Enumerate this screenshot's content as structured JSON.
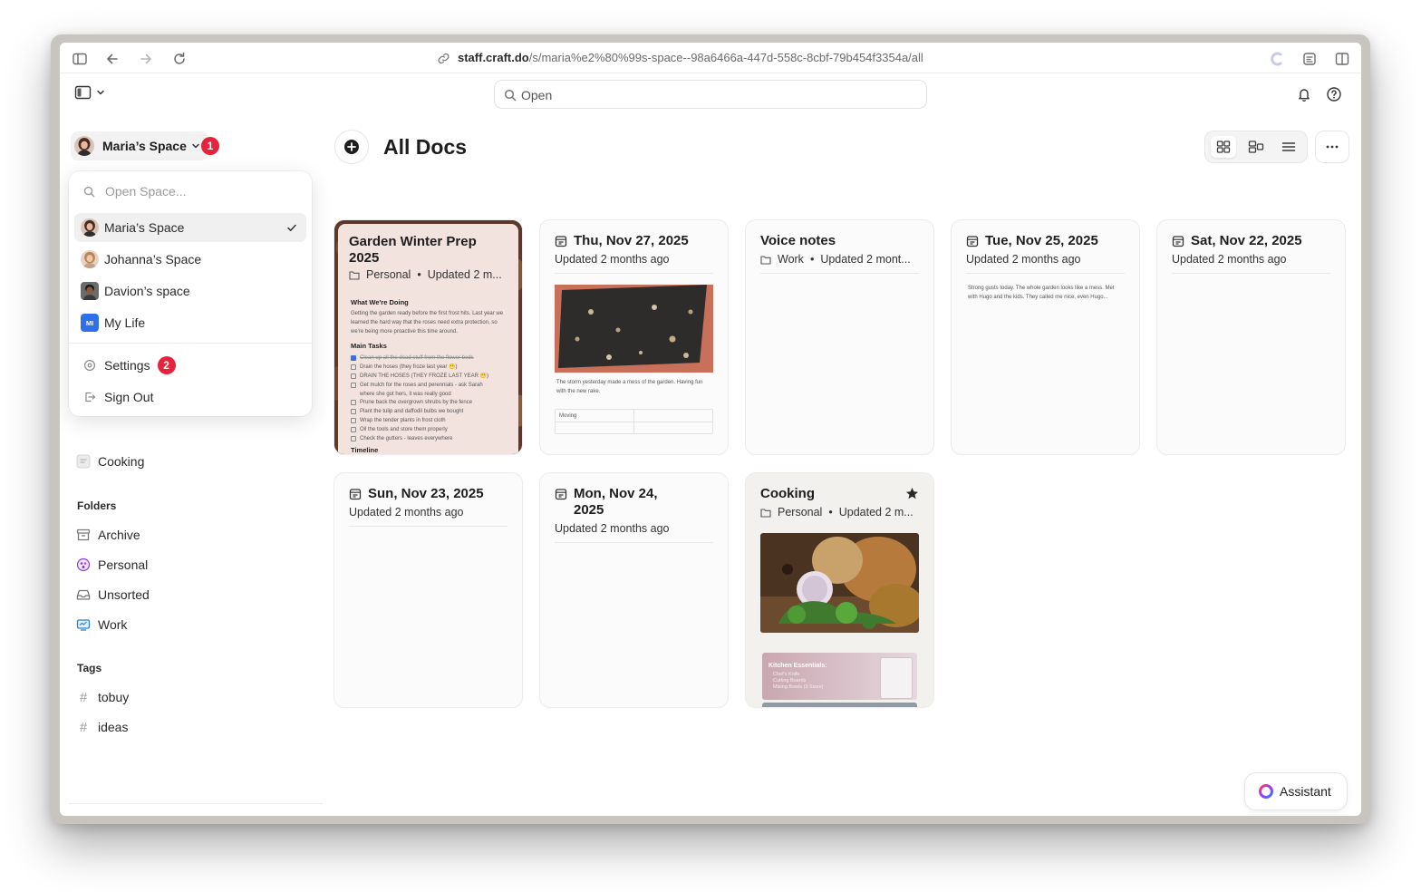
{
  "browser": {
    "url_host": "staff.craft.do",
    "url_path": "/s/maria%e2%80%99s-space--98a6466a-447d-558c-8cbf-79b454f3354a/all"
  },
  "header": {
    "search_placeholder": "Open"
  },
  "space": {
    "name": "Maria’s Space",
    "notification_count": "1"
  },
  "space_menu": {
    "search_placeholder": "Open Space...",
    "spaces": [
      "Maria’s Space",
      "Johanna’s Space",
      "Davion’s space",
      "My Life"
    ],
    "mylife_initials": "MI",
    "settings_label": "Settings",
    "settings_badge": "2",
    "signout_label": "Sign Out"
  },
  "sidebar": {
    "cooking_label": "Cooking",
    "folders_heading": "Folders",
    "folders": [
      "Archive",
      "Personal",
      "Unsorted",
      "Work"
    ],
    "tags_heading": "Tags",
    "tags": [
      "tobuy",
      "ideas"
    ],
    "hash": "#"
  },
  "main": {
    "title": "All Docs",
    "cards": [
      {
        "title": "Garden Winter Prep 2025",
        "folder": "Personal",
        "updated": "Updated 2 m...",
        "preview": {
          "h1": "What We're Doing",
          "p1": "Getting the garden ready before the first frost hits. Last year we learned the hard way that the roses need extra protection, so we're being more proactive this time around.",
          "h2": "Main Tasks",
          "tasks": [
            "Clean up all the dead stuff from the flower beds",
            "Drain the hoses (they froze last year 😬)",
            "DRAIN THE HOSES (THEY FROZE LAST YEAR 😬)",
            "Get mulch for the roses and perennials - ask Sarah where she got hers, it was really good",
            "Prune back the overgrown shrubs by the fence",
            "Plant the tulip and daffodil bulbs we bought",
            "Wrap the tender plants in frost cloth",
            "Oil the tools and store them properly",
            "Check the gutters - leaves everywhere"
          ],
          "h3": "Timeline"
        }
      },
      {
        "title": "Thu, Nov 27, 2025",
        "updated": "Updated 2 months ago",
        "note": "The storm yesterday made a mess of the garden. Having fun with the new rake.",
        "table_cell": "Moving"
      },
      {
        "title": "Voice notes",
        "folder": "Work",
        "updated": "Updated 2 mont..."
      },
      {
        "title": "Tue, Nov 25, 2025",
        "updated": "Updated 2 months ago",
        "note": "Strong gusts today. The whole garden looks like a mess. Met with Hugo and the kids. They called me nice, even Hugo..."
      },
      {
        "title": "Sat, Nov 22, 2025",
        "updated": "Updated 2 months ago"
      },
      {
        "title": "Sun, Nov 23, 2025",
        "updated": "Updated 2 months ago"
      },
      {
        "title": "Mon, Nov 24, 2025",
        "updated": "Updated 2 months ago"
      },
      {
        "title": "Cooking",
        "folder": "Personal",
        "updated": "Updated 2 m...",
        "banner_title": "Kitchen Essentials:",
        "banner_items": [
          "Chef's Knife",
          "Cutting Boards",
          "Mixing Bowls (3 Sizes)"
        ]
      }
    ]
  },
  "assistant_label": "Assistant",
  "colors": {
    "badge": "#e5243b",
    "mylife": "#2f6fe8",
    "personal_folder": "#8a3fd1",
    "work_folder": "#2f7fd9"
  }
}
